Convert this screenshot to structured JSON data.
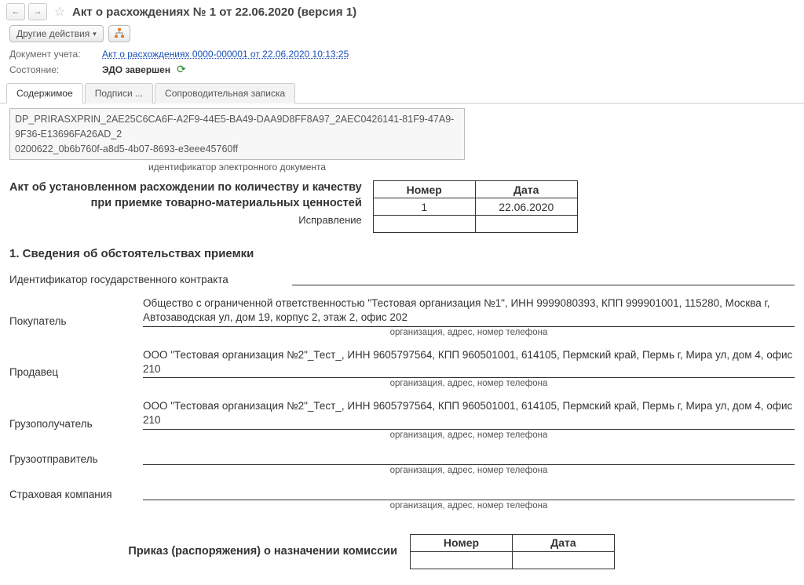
{
  "header": {
    "title": "Акт о расхождениях № 1 от 22.06.2020 (версия 1)"
  },
  "toolbar": {
    "other_actions": "Другие действия"
  },
  "meta": {
    "doc_accounting_label": "Документ учета:",
    "doc_accounting_link": "Акт о расхождениях 0000-000001 от 22.06.2020 10:13:25",
    "status_label": "Состояние:",
    "status_value": "ЭДО завершен"
  },
  "tabs": {
    "content": "Содержимое",
    "signatures": "Подписи ...",
    "cover_note": "Сопроводительная записка"
  },
  "identifier": {
    "line1": "DP_PRIRASXPRIN_2AE25C6CA6F-A2F9-44E5-BA49-DAA9D8FF8A97_2AEC0426141-81F9-47A9-9F36-E13696FA26AD_2",
    "line2": "0200622_0b6b760f-a8d5-4b07-8693-e3eee45760ff",
    "caption": "идентификатор электронного документа"
  },
  "doc_title": {
    "line1": "Акт об установленном расхождении по количеству и качеству",
    "line2": "при приемке товарно-материальных ценностей",
    "correction": "Исправление"
  },
  "num_date": {
    "num_hdr": "Номер",
    "date_hdr": "Дата",
    "num_val": "1",
    "date_val": "22.06.2020"
  },
  "section1_title": "1. Сведения об обстоятельствах приемки",
  "fields": {
    "gov_contract": {
      "label": "Идентификатор государственного контракта",
      "value": ""
    },
    "buyer": {
      "label": "Покупатель",
      "value": "Общество с ограниченной ответственностью \"Тестовая организация №1\", ИНН 9999080393, КПП 999901001, 115280, Москва г, Автозаводская ул, дом 19, корпус 2, этаж 2, офис 202",
      "caption": "организация, адрес, номер телефона"
    },
    "seller": {
      "label": "Продавец",
      "value": "ООО \"Тестовая организация №2\"_Тест_, ИНН 9605797564, КПП 960501001, 614105, Пермский край, Пермь г, Мира ул, дом 4, офис 210",
      "caption": "организация, адрес, номер телефона"
    },
    "consignee": {
      "label": "Грузополучатель",
      "value": "ООО \"Тестовая организация №2\"_Тест_, ИНН 9605797564, КПП 960501001, 614105, Пермский край, Пермь г, Мира ул, дом 4, офис 210",
      "caption": "организация, адрес, номер телефона"
    },
    "shipper": {
      "label": "Грузоотправитель",
      "value": "",
      "caption": "организация, адрес, номер телефона"
    },
    "insurance": {
      "label": "Страховая компания",
      "value": "",
      "caption": "организация, адрес, номер телефона"
    }
  },
  "order": {
    "label": "Приказ (распоряжения) о назначении комиссии",
    "num_hdr": "Номер",
    "date_hdr": "Дата"
  }
}
